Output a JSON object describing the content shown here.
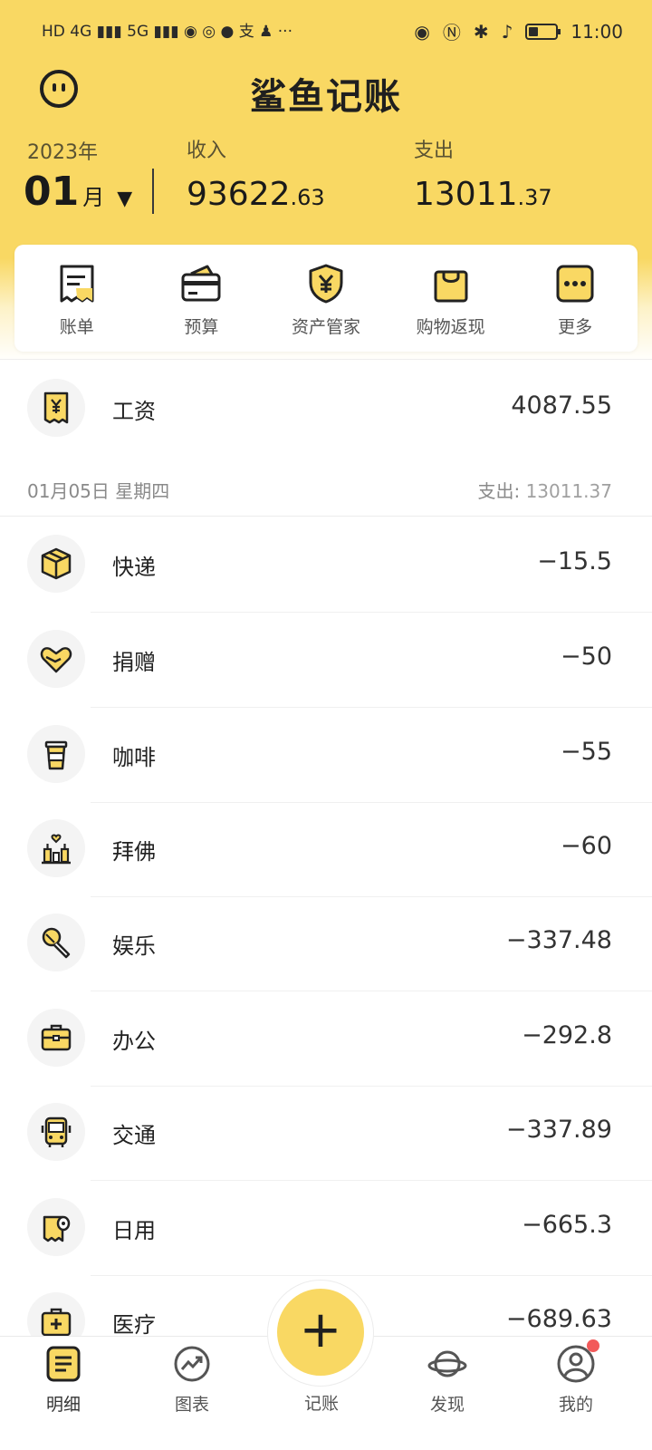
{
  "status_bar": {
    "left_indicators": "HD 4G ▮▮▮ 5G ▮▮▮ ◉ ◎ ● 支 ♟ ···",
    "time": "11:00"
  },
  "header": {
    "app_title": "鲨鱼记账",
    "year": "2023年",
    "month": "01",
    "month_unit": "月",
    "income_label": "收入",
    "income_int": "93622",
    "income_dec": ".63",
    "expense_label": "支出",
    "expense_int": "13011",
    "expense_dec": ".37"
  },
  "quick_actions": [
    {
      "label": "账单",
      "icon": "bill-icon"
    },
    {
      "label": "预算",
      "icon": "wallet-icon"
    },
    {
      "label": "资产管家",
      "icon": "shield-yen-icon"
    },
    {
      "label": "购物返现",
      "icon": "shopping-bag-icon"
    },
    {
      "label": "更多",
      "icon": "more-icon"
    }
  ],
  "income_entry": {
    "category": "工资",
    "amount": "4087.55",
    "icon": "salary-icon"
  },
  "day_group": {
    "date": "01月05日 星期四",
    "expense_label": "支出:",
    "expense_total": "13011.37"
  },
  "transactions": [
    {
      "category": "快递",
      "amount": "−15.5",
      "icon": "box-icon"
    },
    {
      "category": "捐赠",
      "amount": "−50",
      "icon": "heart-hand-icon"
    },
    {
      "category": "咖啡",
      "amount": "−55",
      "icon": "coffee-icon"
    },
    {
      "category": "拜佛",
      "amount": "−60",
      "icon": "candles-icon"
    },
    {
      "category": "娱乐",
      "amount": "−337.48",
      "icon": "microphone-icon"
    },
    {
      "category": "办公",
      "amount": "−292.8",
      "icon": "briefcase-icon"
    },
    {
      "category": "交通",
      "amount": "−337.89",
      "icon": "bus-icon"
    },
    {
      "category": "日用",
      "amount": "−665.3",
      "icon": "tissue-icon"
    },
    {
      "category": "医疗",
      "amount": "−689.63",
      "icon": "medkit-icon"
    }
  ],
  "tabs": [
    {
      "label": "明细",
      "icon": "list-icon"
    },
    {
      "label": "图表",
      "icon": "chart-icon"
    },
    {
      "label": "记账",
      "icon": "plus-icon"
    },
    {
      "label": "发现",
      "icon": "planet-icon"
    },
    {
      "label": "我的",
      "icon": "user-icon"
    }
  ],
  "colors": {
    "accent": "#f9d863",
    "text": "#222222",
    "badge": "#f25a5a"
  }
}
